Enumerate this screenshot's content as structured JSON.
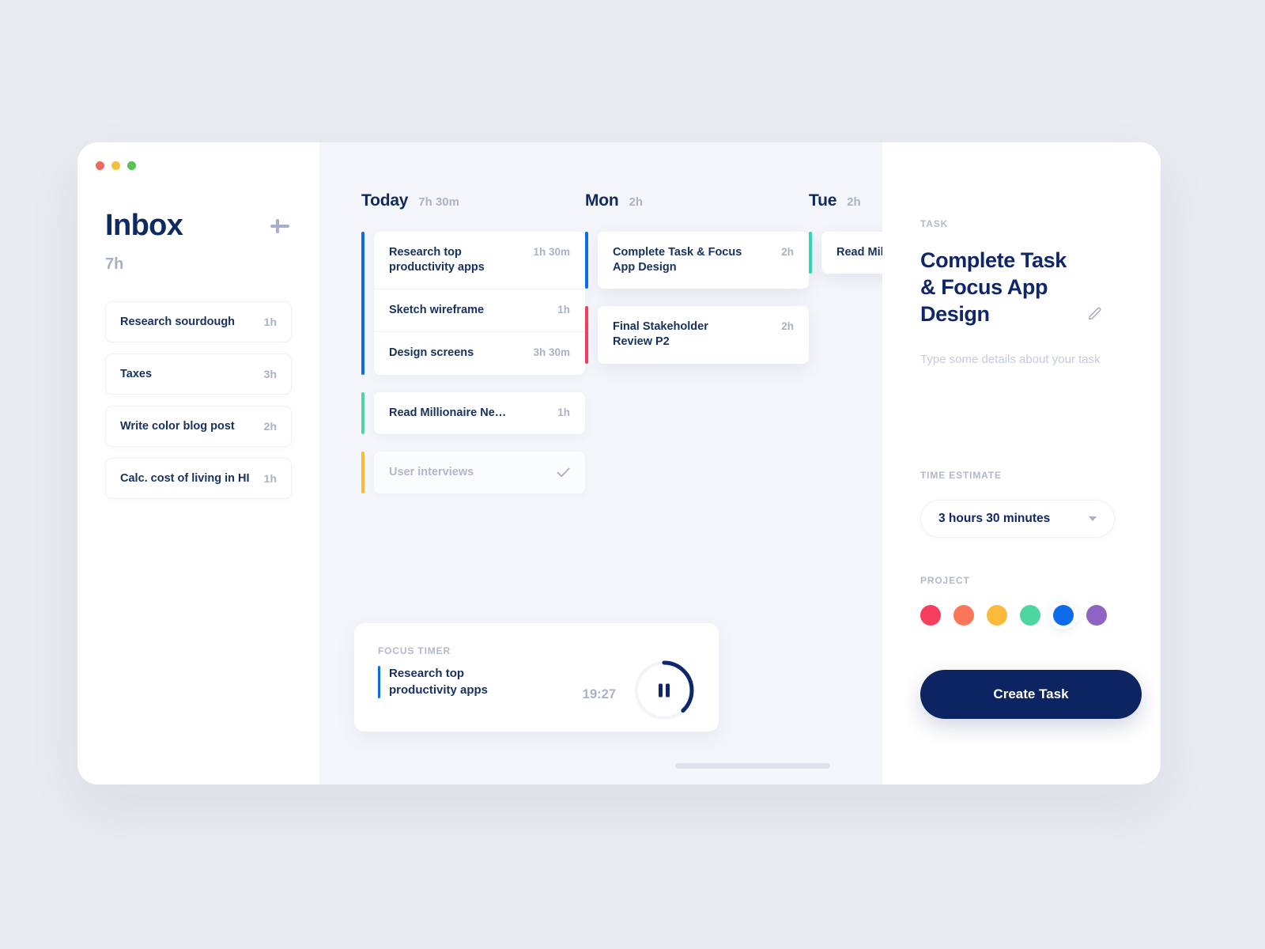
{
  "window": {
    "traffic_lights": [
      "close",
      "minimize",
      "maximize"
    ]
  },
  "sidebar": {
    "title": "Inbox",
    "total_time": "7h",
    "add_button_icon": "plus-icon",
    "items": [
      {
        "title": "Research sourdough",
        "time": "1h"
      },
      {
        "title": "Taxes",
        "time": "3h"
      },
      {
        "title": "Write color blog post",
        "time": "2h"
      },
      {
        "title": "Calc. cost of living in HI",
        "time": "1h"
      }
    ]
  },
  "board": {
    "columns": [
      {
        "title": "Today",
        "total": "7h 30m",
        "groups": [
          {
            "accent": "#0c6ce9",
            "elevated": false,
            "completed": false,
            "rows": [
              {
                "title": "Research top productivity apps",
                "time": "1h 30m"
              },
              {
                "title": "Sketch wireframe",
                "time": "1h"
              },
              {
                "title": "Design screens",
                "time": "3h 30m"
              }
            ]
          },
          {
            "accent": "#4ed6a0",
            "elevated": false,
            "completed": false,
            "rows": [
              {
                "title": "Read Millionaire Next D…",
                "time": "1h",
                "truncate": true
              }
            ]
          },
          {
            "accent": "#fbba3c",
            "elevated": false,
            "completed": true,
            "rows": [
              {
                "title": "User interviews",
                "time": "",
                "check": "check-icon"
              }
            ]
          }
        ]
      },
      {
        "title": "Mon",
        "total": "2h",
        "groups": [
          {
            "accent": "#0c6ce9",
            "elevated": true,
            "completed": false,
            "rows": [
              {
                "title": "Complete Task & Focus App Design",
                "time": "2h"
              }
            ]
          },
          {
            "accent": "#f63e5e",
            "elevated": true,
            "completed": false,
            "rows": [
              {
                "title": "Final Stakeholder Review P2",
                "time": "2h"
              }
            ]
          }
        ]
      },
      {
        "title": "Tue",
        "total": "2h",
        "groups": [
          {
            "accent": "#2fd8b8",
            "elevated": true,
            "completed": false,
            "rows": [
              {
                "title": "Read Millionai",
                "time": ""
              }
            ]
          }
        ]
      }
    ]
  },
  "focus_timer": {
    "label": "FOCUS TIMER",
    "task": "Research top productivity apps",
    "accent": "#0c6ce9",
    "elapsed": "19:27",
    "progress_percent": 38,
    "control_icon": "pause-icon",
    "ring_color": "#10266a"
  },
  "scrollbar": {
    "name": "board-horizontal-scrollbar"
  },
  "detail": {
    "task_label": "TASK",
    "title": "Complete Task & Focus App Design",
    "edit_icon": "pencil-icon",
    "notes_placeholder": "Type some details about your task",
    "notes_value": "",
    "time_estimate_label": "TIME ESTIMATE",
    "time_estimate_value": "3 hours  30 minutes",
    "time_estimate_chevron": "chevron-down-icon",
    "project_label": "PROJECT",
    "project_colors": [
      {
        "name": "crimson",
        "hex": "#f63e5e",
        "selected": false
      },
      {
        "name": "coral",
        "hex": "#fa7659",
        "selected": false
      },
      {
        "name": "amber",
        "hex": "#fbba3c",
        "selected": false
      },
      {
        "name": "green",
        "hex": "#4ed6a0",
        "selected": false
      },
      {
        "name": "blue",
        "hex": "#0c6ce9",
        "selected": true
      },
      {
        "name": "purple",
        "hex": "#8e63c4",
        "selected": false
      }
    ],
    "create_button_label": "Create Task"
  }
}
